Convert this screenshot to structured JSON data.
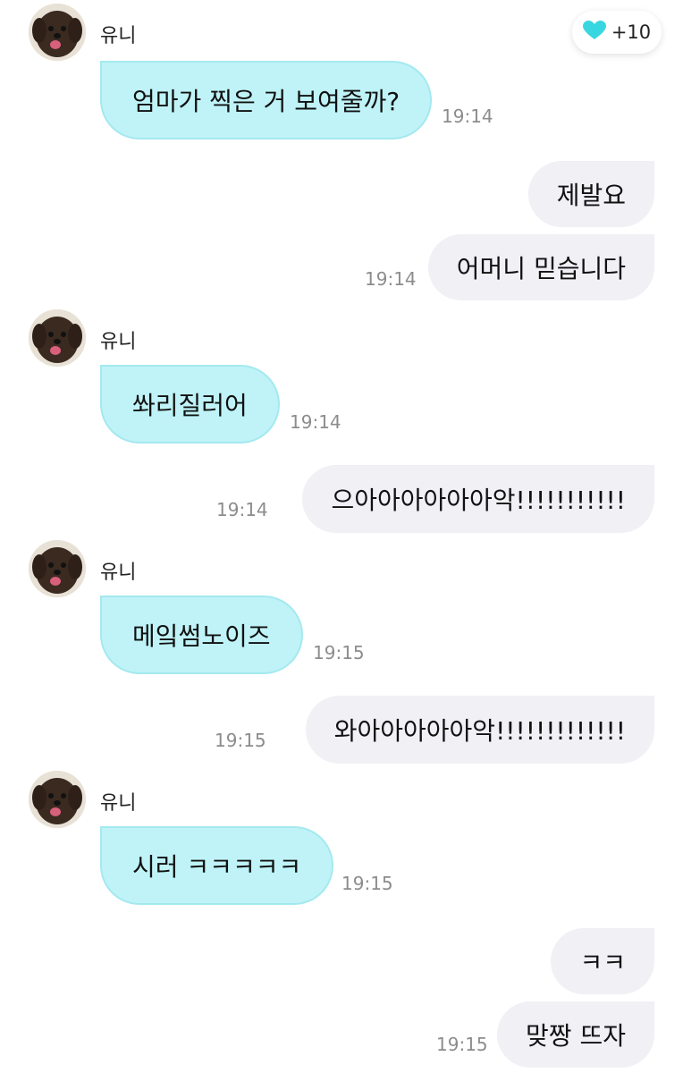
{
  "colors": {
    "incoming_bubble": "#bff3f7",
    "outgoing_bubble": "#f0f0f5",
    "heart": "#38d6e0",
    "timestamp": "#8c8c8c"
  },
  "reaction": {
    "icon": "heart-icon",
    "count": "+10"
  },
  "messages": [
    {
      "sender": "유니",
      "text": "엄마가 찍은 거 보여줄까?",
      "time": "19:14"
    },
    {
      "text": "제발요"
    },
    {
      "text": "어머니 믿습니다",
      "time": "19:14"
    },
    {
      "sender": "유니",
      "text": "쏴리질러어",
      "time": "19:14"
    },
    {
      "text": "으아아아아아아악!!!!!!!!!!!",
      "time": "19:14"
    },
    {
      "sender": "유니",
      "text": "메잌썸노이즈",
      "time": "19:15"
    },
    {
      "text": "와아아아아아악!!!!!!!!!!!!!",
      "time": "19:15"
    },
    {
      "sender": "유니",
      "text": "시러 ㅋㅋㅋㅋㅋ",
      "time": "19:15"
    },
    {
      "text": "ㅋㅋ"
    },
    {
      "text": "맞짱 뜨자",
      "time": "19:15"
    }
  ]
}
